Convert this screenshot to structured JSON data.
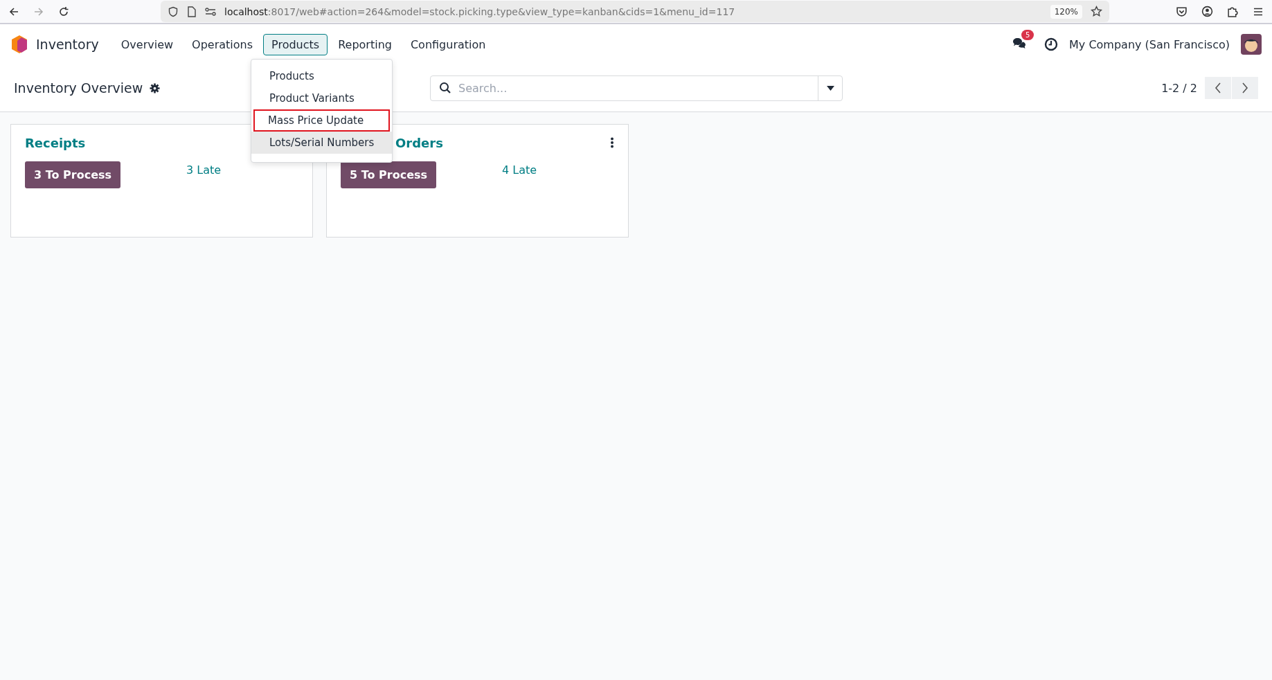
{
  "browser": {
    "url_host": "localhost",
    "url_rest": ":8017/web#action=264&model=stock.picking.type&view_type=kanban&cids=1&menu_id=117",
    "zoom": "120%"
  },
  "app": {
    "name": "Inventory"
  },
  "menu": [
    {
      "label": "Overview",
      "selected": false
    },
    {
      "label": "Operations",
      "selected": false
    },
    {
      "label": "Products",
      "selected": true
    },
    {
      "label": "Reporting",
      "selected": false
    },
    {
      "label": "Configuration",
      "selected": false
    }
  ],
  "dropdown": [
    {
      "label": "Products",
      "highlighted": false,
      "hovered": false
    },
    {
      "label": "Product Variants",
      "highlighted": false,
      "hovered": false
    },
    {
      "label": "Mass Price Update",
      "highlighted": true,
      "hovered": false
    },
    {
      "label": "Lots/Serial Numbers",
      "highlighted": false,
      "hovered": true
    }
  ],
  "systray": {
    "message_count": "5",
    "company": "My Company (San Francisco)"
  },
  "control_panel": {
    "title": "Inventory Overview",
    "search": {
      "placeholder": "Search..."
    },
    "pager": "1-2 / 2"
  },
  "cards": [
    {
      "title": "Receipts",
      "process": "3 To Process",
      "late": "3 Late",
      "covered": false
    },
    {
      "title": "Orders",
      "process": "5 To Process",
      "late": "4 Late",
      "menu_visible": true,
      "covered": true
    }
  ]
}
